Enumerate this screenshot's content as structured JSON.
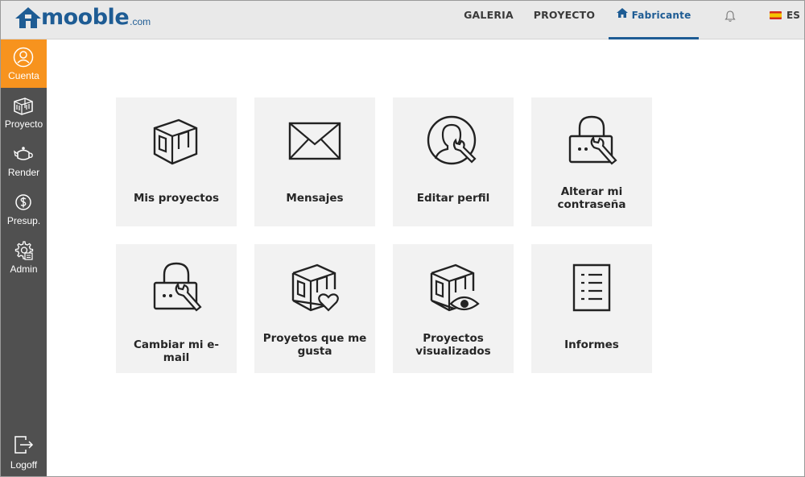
{
  "logo": {
    "text": "mooble",
    "suffix": ".com"
  },
  "nav": {
    "galeria": "GALERIA",
    "proyecto": "PROYECTO",
    "fabricante": "Fabricante",
    "language": "ES"
  },
  "sidebar": {
    "items": [
      {
        "label": "Cuenta",
        "icon": "user-circle-icon",
        "active": true
      },
      {
        "label": "Proyecto",
        "icon": "box-icon"
      },
      {
        "label": "Render",
        "icon": "teapot-icon"
      },
      {
        "label": "Presup.",
        "icon": "dollar-icon"
      },
      {
        "label": "Admin",
        "icon": "gear-icon"
      }
    ],
    "logoff": "Logoff"
  },
  "tiles": [
    {
      "label": "Mis proyectos",
      "icon": "project-box-icon"
    },
    {
      "label": "Mensajes",
      "icon": "envelope-icon"
    },
    {
      "label": "Editar perfil",
      "icon": "edit-profile-icon"
    },
    {
      "label": "Alterar mi contraseña",
      "icon": "lock-wrench-icon"
    },
    {
      "label": "Cambiar mi e-mail",
      "icon": "lock-wrench-icon"
    },
    {
      "label": "Proyetos que me gusta",
      "icon": "box-heart-icon"
    },
    {
      "label": "Proyectos visualizados",
      "icon": "box-eye-icon"
    },
    {
      "label": "Informes",
      "icon": "document-list-icon"
    }
  ],
  "colors": {
    "accent": "#f7931e",
    "brand": "#1e5c94",
    "sidebar": "#505050",
    "tile": "#f2f2f2"
  }
}
